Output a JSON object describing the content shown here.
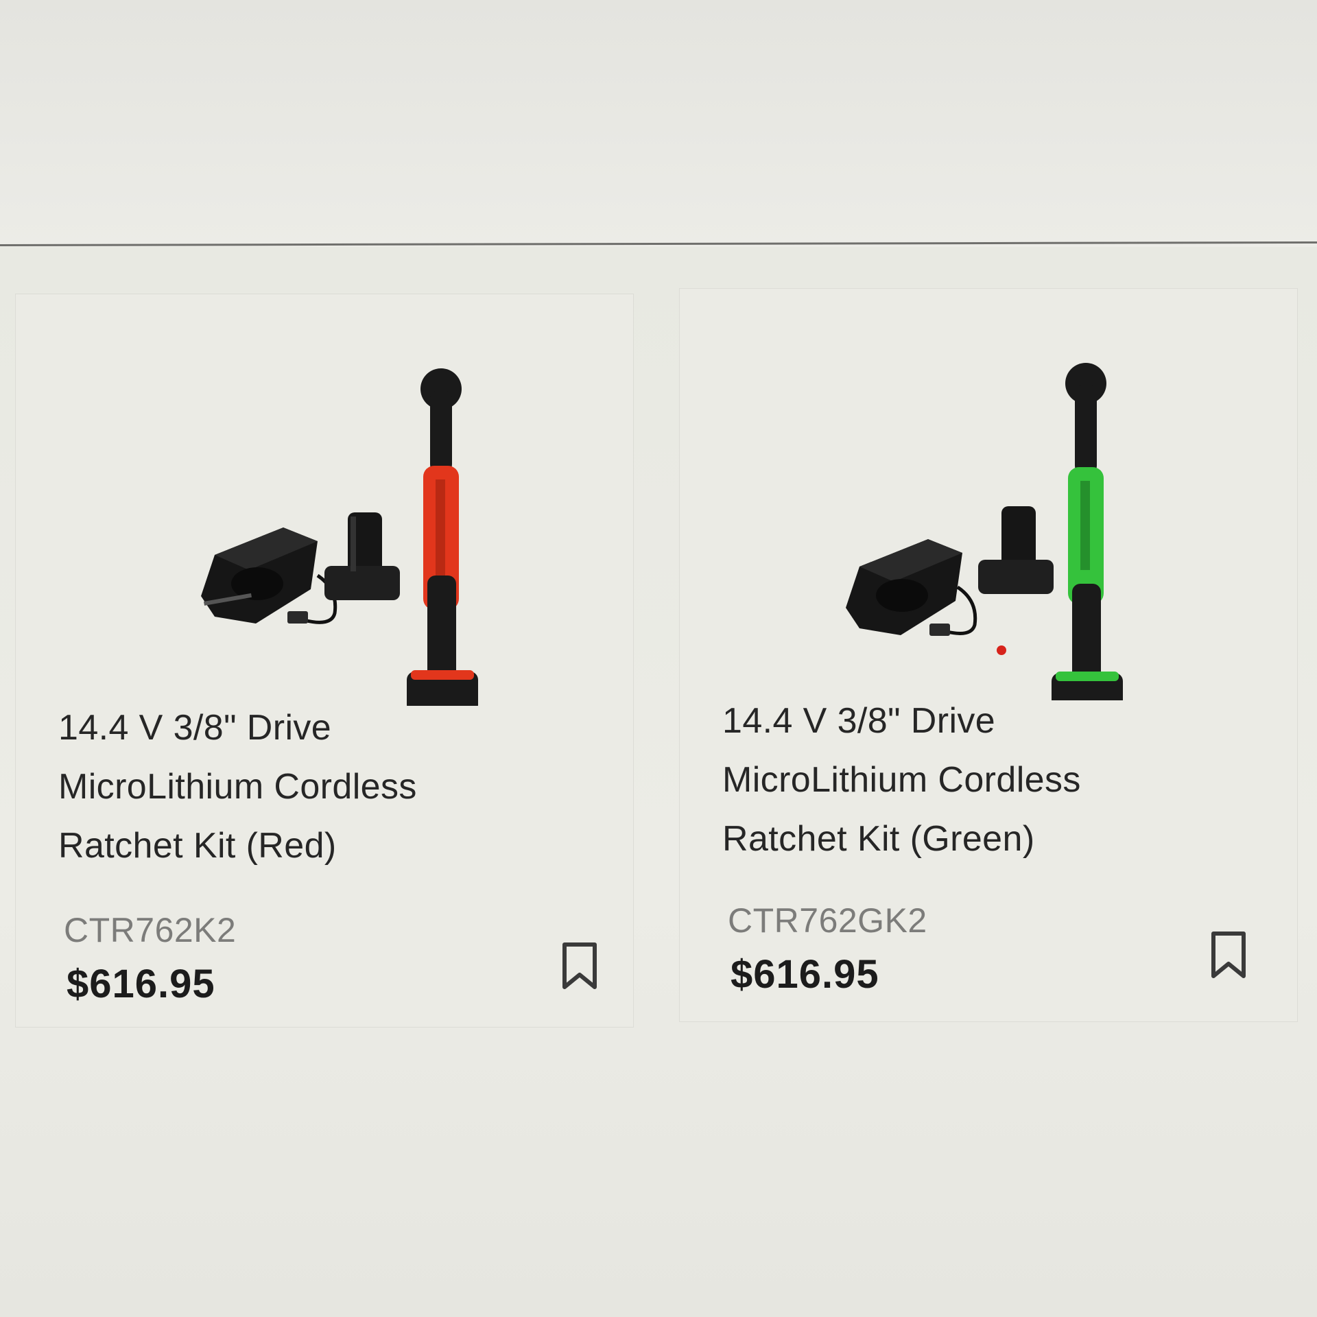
{
  "colors": {
    "red_accent": "#e2361c",
    "green_accent": "#35c23c",
    "tool_black": "#1b1b1b",
    "dot_red": "#d7231b"
  },
  "products": [
    {
      "title_lines": [
        "14.4 V 3/8\" Drive",
        "MicroLithium Cordless",
        "Ratchet Kit (Red)"
      ],
      "sku": "CTR762K2",
      "price": "$616.95",
      "accent": "red",
      "image_icon": "ratchet-kit-red-icon",
      "bookmark_icon": "bookmark-icon"
    },
    {
      "title_lines": [
        "14.4 V 3/8\" Drive",
        "MicroLithium Cordless",
        "Ratchet Kit (Green)"
      ],
      "sku": "CTR762GK2",
      "price": "$616.95",
      "accent": "green",
      "image_icon": "ratchet-kit-green-icon",
      "bookmark_icon": "bookmark-icon"
    }
  ]
}
